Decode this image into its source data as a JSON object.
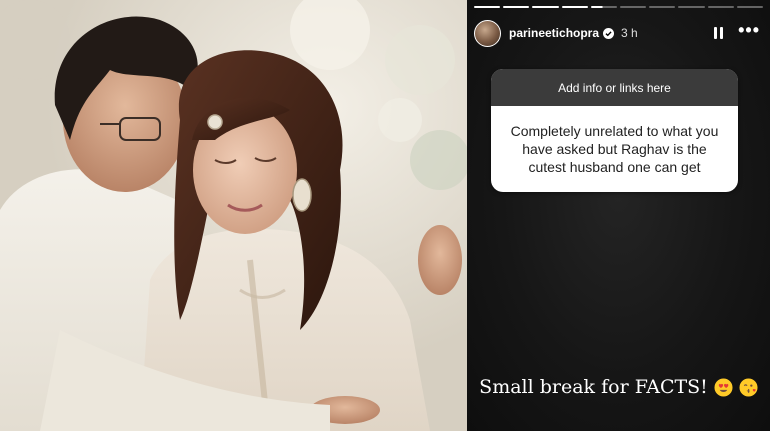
{
  "story": {
    "progress_segments": [
      "done",
      "done",
      "done",
      "done",
      "active",
      "pending",
      "pending",
      "pending",
      "pending",
      "pending"
    ],
    "username": "parineetichopra",
    "time": "3 h",
    "question_sticker": {
      "prompt": "Add info or links here",
      "answer": "Completely unrelated to what you have asked but Raghav is the cutest husband one can get"
    },
    "caption": "Small break for FACTS!",
    "caption_emojis": [
      "heart-eyes-emoji",
      "kissing-face-emoji"
    ],
    "icons": [
      "verified-badge-icon",
      "pause-icon",
      "more-options-icon"
    ]
  },
  "photo": {
    "description_icon": "couple-photo"
  }
}
